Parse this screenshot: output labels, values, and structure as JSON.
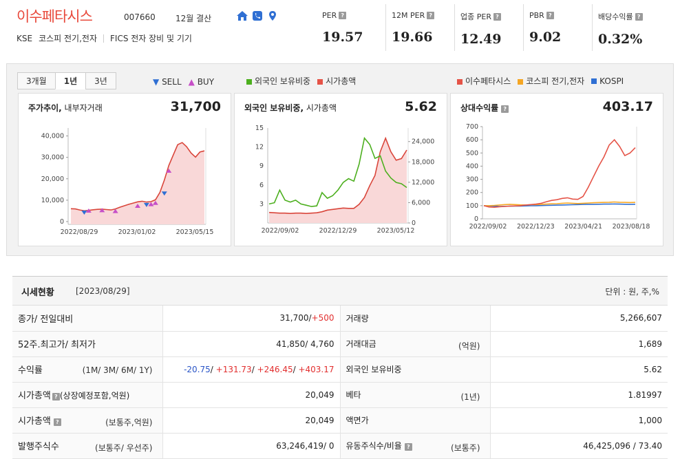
{
  "header": {
    "company_name": "이수페타시스",
    "company_code": "007660",
    "fiscal_month": "12월 결산",
    "market": "KSE",
    "sector": "코스피 전기,전자",
    "fics_label": "FICS 전자 장비 및 기기",
    "icons": [
      "home-icon",
      "phone-icon",
      "location-pin-icon"
    ],
    "metrics": [
      {
        "label": "PER",
        "value": "19.57"
      },
      {
        "label": "12M PER",
        "value": "19.66"
      },
      {
        "label": "업종 PER",
        "value": "12.49"
      },
      {
        "label": "PBR",
        "value": "9.02"
      },
      {
        "label": "배당수익률",
        "value": "0.32%"
      }
    ],
    "help_glyph": "?"
  },
  "chart_panel": {
    "tabs": [
      {
        "label": "3개월",
        "active": false
      },
      {
        "label": "1년",
        "active": true
      },
      {
        "label": "3년",
        "active": false
      }
    ],
    "sell_label": "SELL",
    "buy_label": "BUY",
    "sell_glyph": "▼",
    "buy_glyph": "▲",
    "legend_mid": [
      {
        "label": "외국인 보유비중",
        "color": "#4caf1e"
      },
      {
        "label": "시가총액",
        "color": "#e55347"
      }
    ],
    "legend_right": [
      {
        "label": "이수페타시스",
        "color": "#e55347"
      },
      {
        "label": "코스피 전기,전자",
        "color": "#f5a623"
      },
      {
        "label": "KOSPI",
        "color": "#2f6fd3"
      }
    ],
    "charts": {
      "price": {
        "title_bold": "주가추이,",
        "title_rest": " 내부자거래",
        "value": "31,700"
      },
      "foreign": {
        "title_bold": "외국인 보유비중,",
        "title_rest": " 시가총액",
        "value": "5.62"
      },
      "relative": {
        "title_bold": "상대수익률",
        "value": "403.17"
      }
    }
  },
  "chart_data": [
    {
      "type": "line",
      "series": [
        {
          "values": [
            6200,
            6100,
            5600,
            5200,
            5400,
            5700,
            5900,
            6000,
            5800,
            5600,
            6100,
            6900,
            7600,
            8300,
            8900,
            9500,
            9800,
            9400,
            9600,
            10500,
            14000,
            20000,
            27000,
            32000,
            37000,
            38000,
            36000,
            33000,
            31000,
            33500,
            34000
          ]
        }
      ],
      "x_ticks": [
        "2022/08/29",
        "2023/01/02",
        "2023/05/15"
      ],
      "y_ticks": [
        "0",
        "10,000",
        "20,000",
        "30,000",
        "40,000"
      ],
      "ylim": [
        0,
        45000
      ],
      "markers": [
        {
          "type": "sell",
          "index": 3,
          "value": 4300
        },
        {
          "type": "buy",
          "index": 4,
          "value": 5300
        },
        {
          "type": "buy",
          "index": 7,
          "value": 5500
        },
        {
          "type": "buy",
          "index": 10,
          "value": 5100
        },
        {
          "type": "buy",
          "index": 15,
          "value": 7600
        },
        {
          "type": "sell",
          "index": 17,
          "value": 8000
        },
        {
          "type": "buy",
          "index": 18,
          "value": 8400
        },
        {
          "type": "buy",
          "index": 19,
          "value": 9000
        },
        {
          "type": "sell",
          "index": 21,
          "value": 13500
        },
        {
          "type": "buy",
          "index": 22,
          "value": 24500
        }
      ]
    },
    {
      "type": "line",
      "series": [
        {
          "axis": "left",
          "color": "#4caf1e",
          "values": [
            3.0,
            3.2,
            5.2,
            3.6,
            3.3,
            3.6,
            3.0,
            2.8,
            2.6,
            2.7,
            4.8,
            3.9,
            4.3,
            5.2,
            6.4,
            7.0,
            6.6,
            9.3,
            13.4,
            12.4,
            10.2,
            10.6,
            8.2,
            7.1,
            6.4,
            6.2,
            5.6
          ]
        },
        {
          "axis": "right",
          "color": "#e55347",
          "values": [
            3100,
            3000,
            2900,
            2900,
            2800,
            2900,
            2900,
            2800,
            2900,
            3000,
            3300,
            3800,
            4000,
            4200,
            4400,
            4300,
            4300,
            5500,
            7500,
            11000,
            14000,
            21000,
            25000,
            21000,
            18500,
            19000,
            21500
          ]
        }
      ],
      "x_ticks": [
        "2022/09/02",
        "2022/12/29",
        "2023/05/12"
      ],
      "y_ticks_left": [
        "3",
        "6",
        "9",
        "12",
        "15"
      ],
      "y_ticks_right": [
        "0",
        "6,000",
        "12,000",
        "18,000",
        "24,000"
      ],
      "ylim_left": [
        0,
        15
      ],
      "ylim_right": [
        0,
        28000
      ]
    },
    {
      "type": "line",
      "series": [
        {
          "color": "#e55347",
          "values": [
            100,
            90,
            88,
            92,
            94,
            96,
            98,
            100,
            105,
            108,
            112,
            118,
            130,
            140,
            145,
            155,
            160,
            150,
            148,
            170,
            240,
            320,
            400,
            470,
            560,
            600,
            550,
            480,
            500,
            540
          ]
        },
        {
          "color": "#f5a623",
          "values": [
            100,
            100,
            102,
            105,
            108,
            110,
            108,
            106,
            105,
            107,
            108,
            110,
            112,
            114,
            115,
            118,
            120,
            118,
            116,
            118,
            120,
            122,
            124,
            125,
            126,
            128,
            126,
            125,
            124,
            125
          ]
        },
        {
          "color": "#2f6fd3",
          "values": [
            100,
            98,
            96,
            94,
            95,
            96,
            97,
            97,
            98,
            99,
            100,
            101,
            102,
            103,
            104,
            105,
            106,
            107,
            108,
            109,
            110,
            110,
            111,
            112,
            112,
            113,
            112,
            111,
            110,
            111
          ]
        }
      ],
      "x_ticks": [
        "2022/09/02",
        "2022/12/23",
        "2023/04/21",
        "2023/08/18"
      ],
      "y_ticks": [
        "0",
        "100",
        "200",
        "300",
        "400",
        "500",
        "600",
        "700"
      ],
      "ylim": [
        0,
        700
      ]
    }
  ],
  "quote": {
    "title": "시세현황",
    "date": "[2023/08/29]",
    "unit": "단위 : 원, 주,%",
    "rows": [
      {
        "label": "종가/ 전일대비",
        "sub": "",
        "value": "31,700/",
        "value_extra": "+500",
        "label2": "거래량",
        "sub2": "",
        "value2": "5,266,607"
      },
      {
        "label": "52주.최고가/ 최저가",
        "sub": "",
        "value": "41,850/ 4,760",
        "value_extra": "",
        "label2": "거래대금",
        "sub2": "(억원)",
        "value2": "1,689"
      },
      {
        "label": "수익률",
        "sub": "(1M/ 3M/ 6M/ 1Y)",
        "returns": [
          "-20.75",
          "+131.73",
          "+246.45",
          "+403.17"
        ],
        "label2": "외국인 보유비중",
        "sub2": "",
        "value2": "5.62"
      },
      {
        "label": "시가총액",
        "sub": "(상장예정포함,억원)",
        "value": "20,049",
        "value_extra": "",
        "label2": "베타",
        "sub2": "(1년)",
        "value2": "1.81997"
      },
      {
        "label": "시가총액",
        "sub": "(보통주,억원)",
        "value": "20,049",
        "value_extra": "",
        "label2": "액면가",
        "sub2": "",
        "value2": "1,000"
      },
      {
        "label": "발행주식수",
        "sub": "(보통주/ 우선주)",
        "value": "63,246,419/ 0",
        "value_extra": "",
        "label2": "유동주식수/비율",
        "sub2": "(보통주)",
        "value2": "46,425,096 / 73.40"
      }
    ]
  }
}
